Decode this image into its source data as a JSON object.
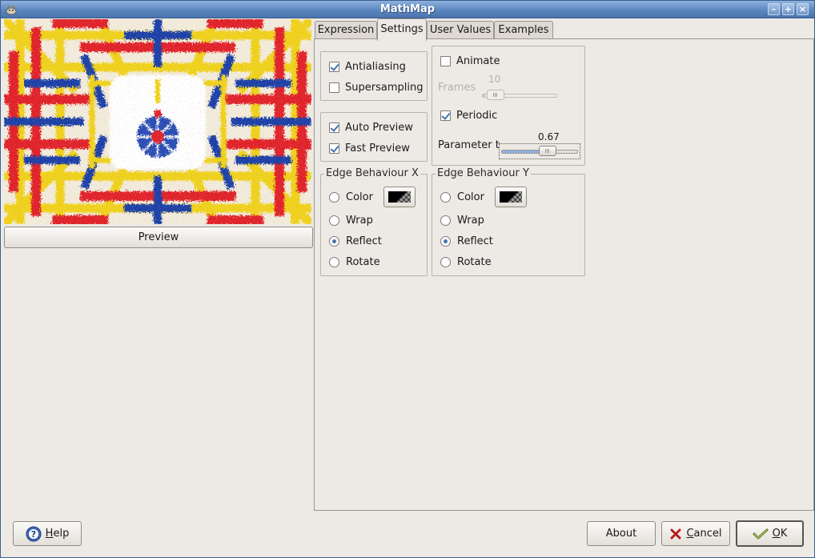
{
  "window": {
    "title": "MathMap"
  },
  "preview": {
    "button_label": "Preview"
  },
  "tabs": [
    {
      "label": "Expression",
      "active": false
    },
    {
      "label": "Settings",
      "active": true
    },
    {
      "label": "User Values",
      "active": false
    },
    {
      "label": "Examples",
      "active": false
    }
  ],
  "render_options": {
    "antialiasing": {
      "label": "Antialiasing",
      "checked": true
    },
    "supersampling": {
      "label": "Supersampling",
      "checked": false
    }
  },
  "preview_options": {
    "auto_preview": {
      "label": "Auto Preview",
      "checked": true
    },
    "fast_preview": {
      "label": "Fast Preview",
      "checked": true
    }
  },
  "animation": {
    "animate": {
      "label": "Animate",
      "checked": false
    },
    "frames": {
      "label": "Frames",
      "value": "10",
      "enabled": false,
      "fraction": 0.0
    },
    "periodic": {
      "label": "Periodic",
      "checked": true
    },
    "parameter_t": {
      "label": "Parameter t",
      "value": "0.67",
      "fraction": 0.67
    }
  },
  "edge_x": {
    "title": "Edge Behaviour X",
    "options": [
      "Color",
      "Wrap",
      "Reflect",
      "Rotate"
    ],
    "selected": "Reflect"
  },
  "edge_y": {
    "title": "Edge Behaviour Y",
    "options": [
      "Color",
      "Wrap",
      "Reflect",
      "Rotate"
    ],
    "selected": "Reflect"
  },
  "buttons": {
    "help": {
      "prefix": "",
      "mnemonic": "H",
      "rest": "elp"
    },
    "about": {
      "label": "About"
    },
    "cancel": {
      "prefix": "",
      "mnemonic": "C",
      "rest": "ancel"
    },
    "ok": {
      "prefix": "",
      "mnemonic": "O",
      "rest": "K"
    }
  },
  "colors": {
    "title_bar": "#5c86bf",
    "accent": "#4a73b0",
    "dialog_bg": "#edeae5"
  }
}
